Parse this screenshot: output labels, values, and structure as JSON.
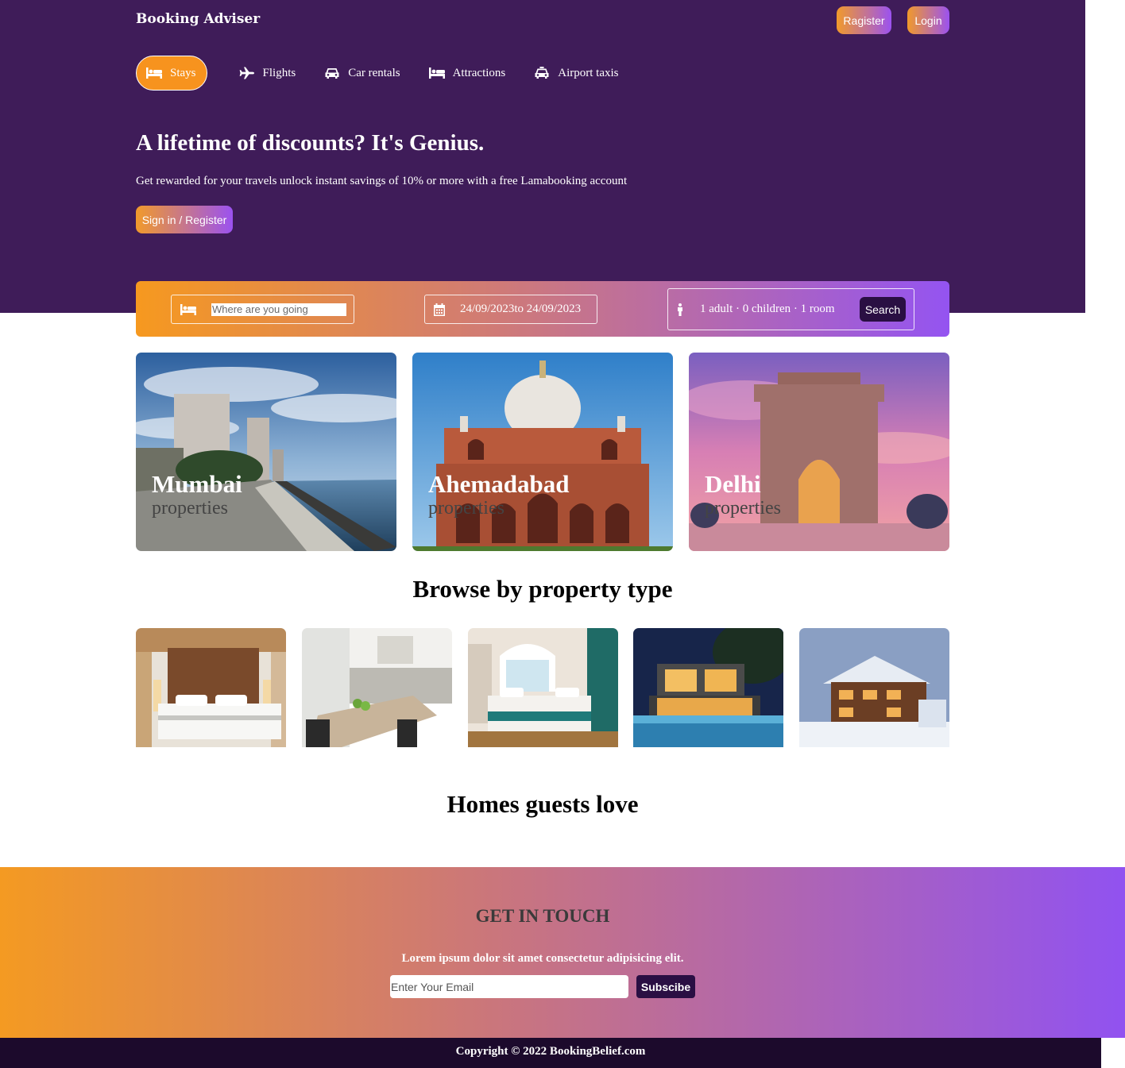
{
  "brand": "Booking Adviser",
  "auth": {
    "register": "Ragister",
    "login": "Login"
  },
  "nav": [
    {
      "label": "Stays",
      "icon": "bed-icon",
      "active": true
    },
    {
      "label": "Flights",
      "icon": "plane-icon"
    },
    {
      "label": "Car rentals",
      "icon": "car-icon"
    },
    {
      "label": "Attractions",
      "icon": "bed-icon"
    },
    {
      "label": "Airport taxis",
      "icon": "taxi-icon"
    }
  ],
  "hero": {
    "title": "A lifetime of discounts? It's Genius.",
    "description": "Get rewarded for your travels unlock instant savings of 10% or more with a free Lamabooking account",
    "button": "Sign in / Register"
  },
  "search": {
    "destination_placeholder": "Where are you going",
    "dates": "24/09/2023to 24/09/2023",
    "guests": "1 adult · 0 children · 1 room",
    "button": "Search"
  },
  "featured": [
    {
      "name": "Mumbai",
      "sub": "properties"
    },
    {
      "name": "Ahemadabad",
      "sub": "properties"
    },
    {
      "name": "Delhi",
      "sub": "properties"
    }
  ],
  "property_section_title": "Browse by property type",
  "homes_section_title": "Homes guests love",
  "newsletter": {
    "title": "GET IN TOUCH",
    "description": "Lorem ipsum dolor sit amet consectetur adipisicing elit.",
    "email_placeholder": "Enter Your Email",
    "button": "Subscibe"
  },
  "copyright": "Copyright © 2022 BookingBelief.com",
  "colors": {
    "header": "#3f1c59",
    "accent_orange": "#f7931e",
    "accent_purple": "#9152f0",
    "dark_button": "#2a0f43",
    "footer_bar": "#1c0a2c"
  }
}
